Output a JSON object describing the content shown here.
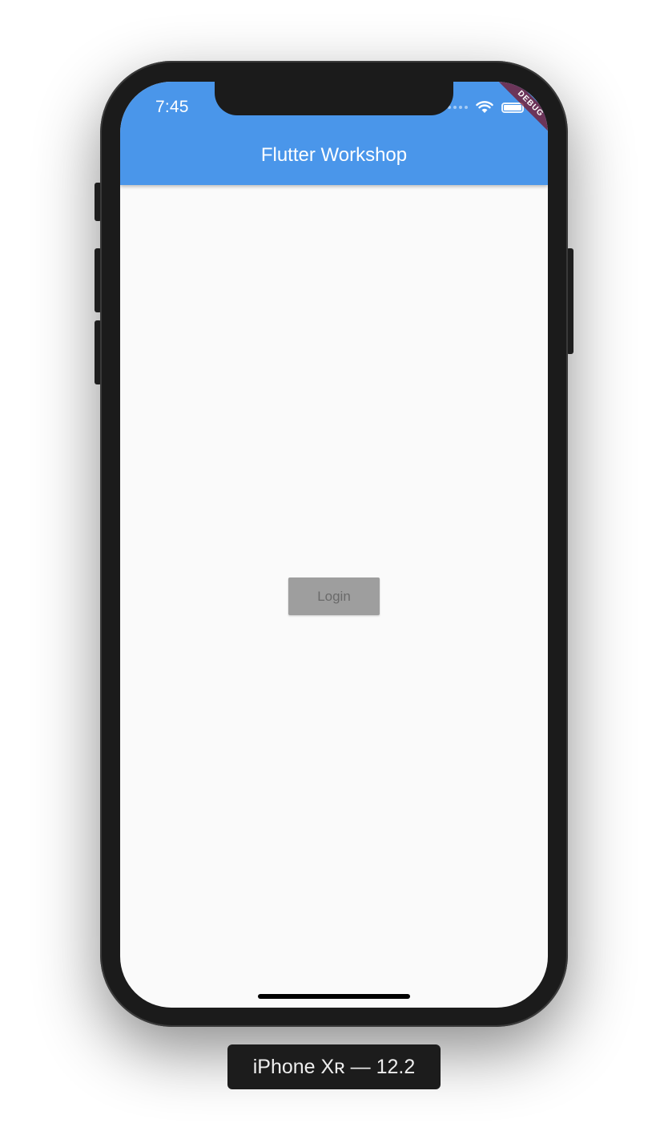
{
  "status_bar": {
    "time": "7:45"
  },
  "app_bar": {
    "title": "Flutter Workshop",
    "color": "#4a96ea"
  },
  "debug_banner": {
    "label": "DEBUG"
  },
  "main": {
    "login_label": "Login"
  },
  "device": {
    "label": "iPhone Xʀ — 12.2"
  },
  "icons": [
    "wifi-icon",
    "battery-icon",
    "cellular-signal-icon"
  ]
}
